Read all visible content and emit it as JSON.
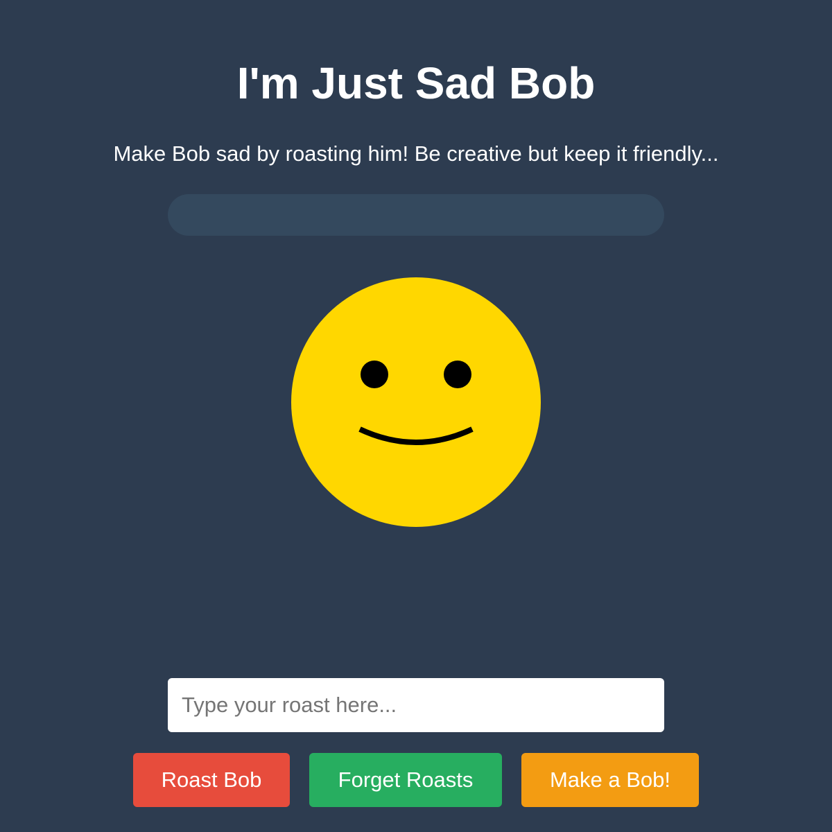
{
  "header": {
    "title": "I'm Just Sad Bob",
    "subtitle": "Make Bob sad by roasting him! Be creative but keep it friendly..."
  },
  "sadness_meter": {
    "level_percent": 0,
    "track_color": "#34495e"
  },
  "bob": {
    "mood": "content",
    "face_color": "#ffd700",
    "feature_color": "#000000"
  },
  "roast_input": {
    "value": "",
    "placeholder": "Type your roast here..."
  },
  "buttons": {
    "roast_label": "Roast Bob",
    "forget_label": "Forget Roasts",
    "make_label": "Make a Bob!"
  },
  "colors": {
    "background": "#2d3c50",
    "roast_button": "#e74c3c",
    "forget_button": "#27ae60",
    "make_button": "#f39c12"
  }
}
